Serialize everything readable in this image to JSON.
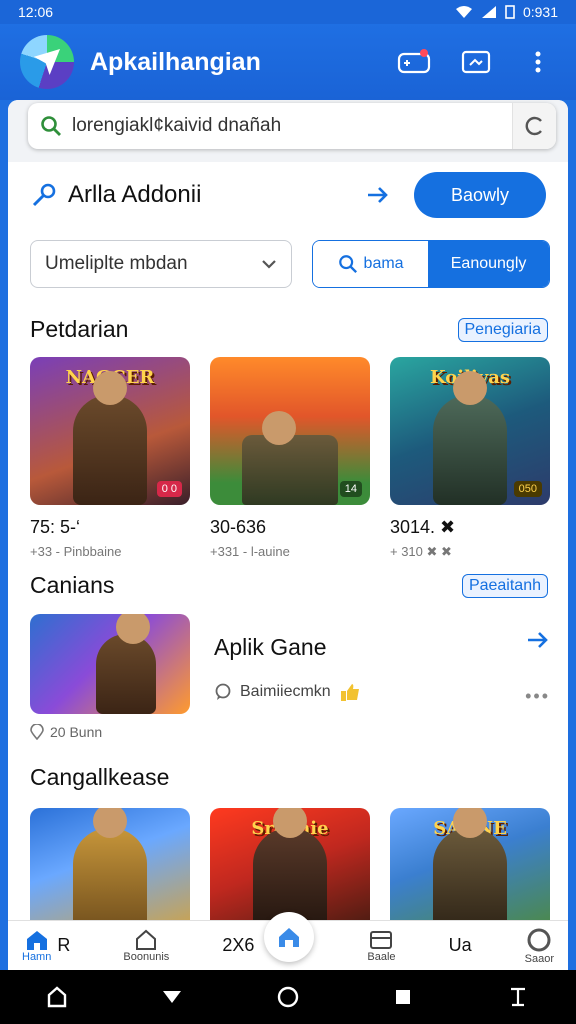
{
  "status_bar": {
    "time": "12:06",
    "right_time": "0:931"
  },
  "app_bar": {
    "title": "Apkailhangian"
  },
  "search": {
    "value": "lorengiakl¢kaivid dnañah"
  },
  "action_row": {
    "label": "Arlla Addonii",
    "button_label": "Baowly"
  },
  "filters": {
    "select_value": "Umeliplte mbdan",
    "segment_left": "bama",
    "segment_right": "Eanoungly"
  },
  "section1": {
    "title": "Petdarian",
    "link": "Penegiaria",
    "cards": [
      {
        "art_title": "NAGCER",
        "badge": "0 0",
        "number": "75: 5-‘",
        "sub": "+33 - Pinbbaine",
        "palette": [
          "#6a3aa8",
          "#d7733a"
        ]
      },
      {
        "art_title": "",
        "badge": "14",
        "number": "30-636",
        "sub": "+331 - l-auine",
        "palette": [
          "#e2562a",
          "#3c8c3a"
        ]
      },
      {
        "art_title": "Koilivas",
        "badge": "050",
        "number": "3014. ✖",
        "sub": "+ 310 ✖ ✖",
        "palette": [
          "#1d7d8c",
          "#2d3b6b"
        ]
      }
    ]
  },
  "section2": {
    "title": "Canians",
    "link": "Paeaitanh",
    "featured": {
      "title": "Aplik Gane",
      "meta": "Baimiiecmkn",
      "foot": "20 Bunn"
    }
  },
  "section3": {
    "title": "Cangallkease",
    "cards": [
      {
        "art_title": "",
        "palette": [
          "#2b71d8",
          "#d6a23a"
        ]
      },
      {
        "art_title": "Sraanie",
        "palette": [
          "#c0281f",
          "#3b1a10"
        ]
      },
      {
        "art_title": "SANNE",
        "palette": [
          "#3b7fd0",
          "#4e8a3a"
        ]
      }
    ]
  },
  "bottom_nav": {
    "home": "Hamn",
    "r_label": "R",
    "second": "Boonunis",
    "center_text": "2X6",
    "store": "Baale",
    "ua": "Ua",
    "last": "Saaor"
  },
  "colors": {
    "accent": "#1570e0",
    "app_bar": "#1f6fe3"
  }
}
